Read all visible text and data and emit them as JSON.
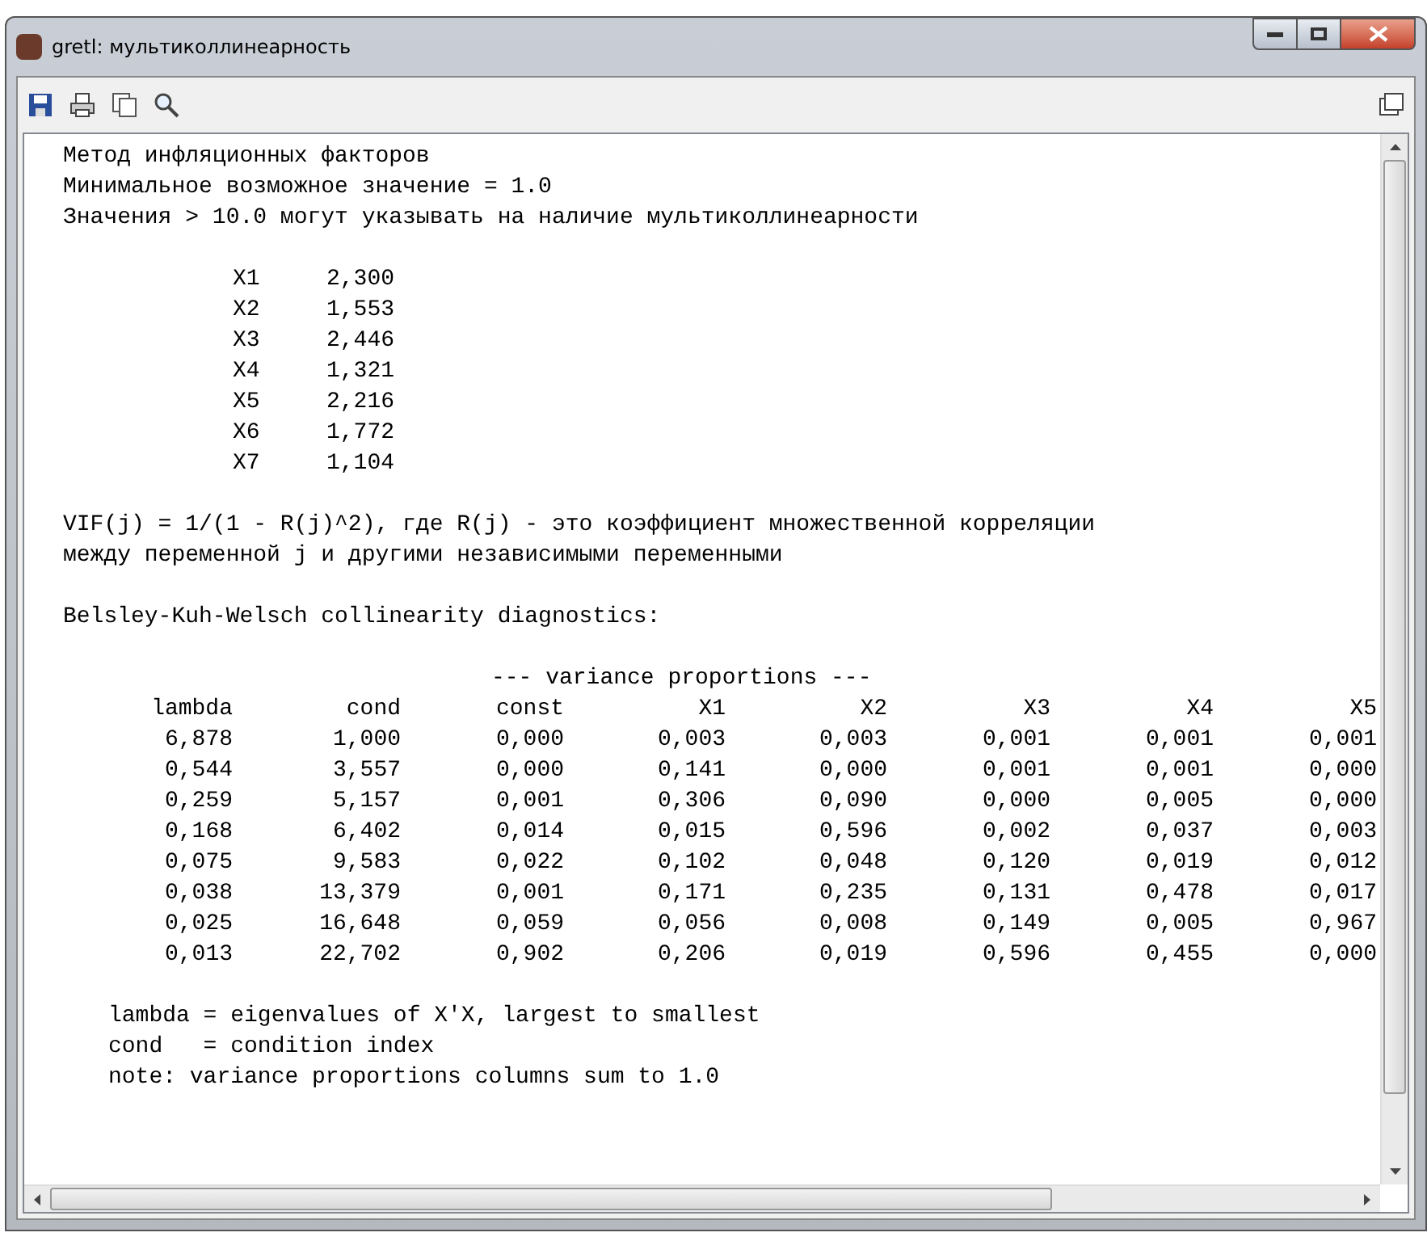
{
  "window": {
    "title": "gretl: мультиколлинеарность"
  },
  "intro": [
    "Метод инфляционных факторов",
    "Минимальное возможное значение = 1.0",
    "Значения > 10.0 могут указывать на наличие мультиколлинеарности"
  ],
  "vif": [
    {
      "name": "X1",
      "value": "2,300"
    },
    {
      "name": "X2",
      "value": "1,553"
    },
    {
      "name": "X3",
      "value": "2,446"
    },
    {
      "name": "X4",
      "value": "1,321"
    },
    {
      "name": "X5",
      "value": "2,216"
    },
    {
      "name": "X6",
      "value": "1,772"
    },
    {
      "name": "X7",
      "value": "1,104"
    }
  ],
  "formula": [
    "VIF(j) = 1/(1 - R(j)^2), где R(j) - это коэффициент множественной корреляции",
    "между переменной j и другими независимыми переменными"
  ],
  "diagnostics_heading": "Belsley-Kuh-Welsch collinearity diagnostics:",
  "table": {
    "group_heading": "--- variance proportions ---",
    "columns": [
      "lambda",
      "cond",
      "const",
      "X1",
      "X2",
      "X3",
      "X4",
      "X5"
    ],
    "rows": [
      [
        "6,878",
        "1,000",
        "0,000",
        "0,003",
        "0,003",
        "0,001",
        "0,001",
        "0,001"
      ],
      [
        "0,544",
        "3,557",
        "0,000",
        "0,141",
        "0,000",
        "0,001",
        "0,001",
        "0,000"
      ],
      [
        "0,259",
        "5,157",
        "0,001",
        "0,306",
        "0,090",
        "0,000",
        "0,005",
        "0,000"
      ],
      [
        "0,168",
        "6,402",
        "0,014",
        "0,015",
        "0,596",
        "0,002",
        "0,037",
        "0,003"
      ],
      [
        "0,075",
        "9,583",
        "0,022",
        "0,102",
        "0,048",
        "0,120",
        "0,019",
        "0,012"
      ],
      [
        "0,038",
        "13,379",
        "0,001",
        "0,171",
        "0,235",
        "0,131",
        "0,478",
        "0,017"
      ],
      [
        "0,025",
        "16,648",
        "0,059",
        "0,056",
        "0,008",
        "0,149",
        "0,005",
        "0,967"
      ],
      [
        "0,013",
        "22,702",
        "0,902",
        "0,206",
        "0,019",
        "0,596",
        "0,455",
        "0,000"
      ]
    ]
  },
  "notes": [
    "lambda = eigenvalues of X'X, largest to smallest",
    "cond   = condition index",
    "note: variance proportions columns sum to 1.0"
  ]
}
